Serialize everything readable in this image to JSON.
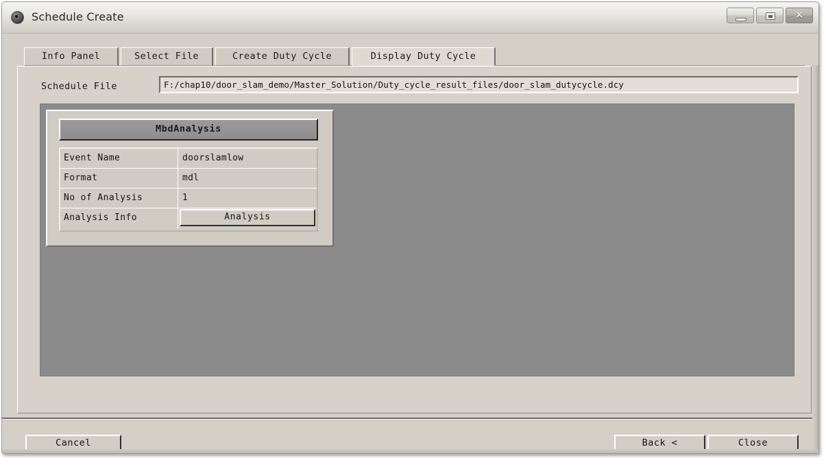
{
  "window": {
    "title": "Schedule Create",
    "icon": "sphere-icon",
    "controls": {
      "minimize": "minimize-icon",
      "maximize": "maximize-icon",
      "close": "✕"
    }
  },
  "tabs": [
    {
      "label": "Info Panel",
      "active": false
    },
    {
      "label": "Select File",
      "active": false
    },
    {
      "label": "Create Duty Cycle",
      "active": false
    },
    {
      "label": "Display Duty Cycle",
      "active": true
    }
  ],
  "form": {
    "schedule_file_label": "Schedule File",
    "schedule_file_value": "F:/chap10/door_slam_demo/Master_Solution/Duty_cycle_result_files/door_slam_dutycycle.dcy"
  },
  "table": {
    "header": "MbdAnalysis",
    "rows": [
      {
        "key": "Event Name",
        "value": "doorslamlow",
        "is_button": false
      },
      {
        "key": "Format",
        "value": "mdl",
        "is_button": false
      },
      {
        "key": "No of Analysis",
        "value": "1",
        "is_button": false
      },
      {
        "key": "Analysis Info",
        "value": "Analysis",
        "is_button": true
      }
    ]
  },
  "footer": {
    "cancel": "Cancel",
    "back": "Back   <",
    "close": "Close"
  },
  "colors": {
    "dialog_face": "#d4d0c8",
    "canvas": "#8b8b8b",
    "table_header": "#8e8e8e",
    "text": "#141414"
  }
}
